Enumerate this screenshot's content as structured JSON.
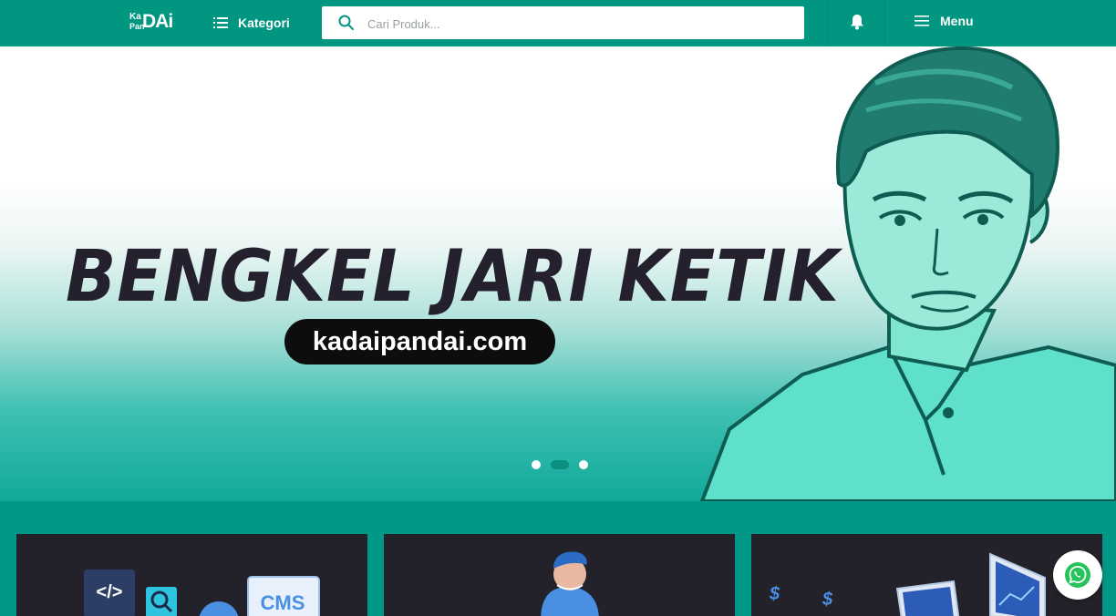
{
  "header": {
    "logo": {
      "ka": "Ka",
      "pan": "Pan",
      "dai": "DAi"
    },
    "kategori_label": "Kategori",
    "search_placeholder": "Cari Produk...",
    "menu_label": "Menu",
    "icons": [
      "list-icon",
      "search-icon",
      "bell-icon",
      "hamburger-icon"
    ]
  },
  "hero": {
    "title": "BENGKEL JARI KETIK",
    "site": "kadaipandai.com",
    "slides": 3,
    "active_slide": 2
  },
  "cards": [
    {
      "name": "card-web-development",
      "labels": [
        "</>",
        "CMS"
      ]
    },
    {
      "name": "card-person-illustration",
      "labels": []
    },
    {
      "name": "card-finance-charts",
      "labels": [
        "$",
        "$"
      ]
    }
  ],
  "colors": {
    "primary": "#01967f",
    "hero_text": "#24202d",
    "card_bg": "#23222a",
    "whatsapp": "#25c35a"
  }
}
